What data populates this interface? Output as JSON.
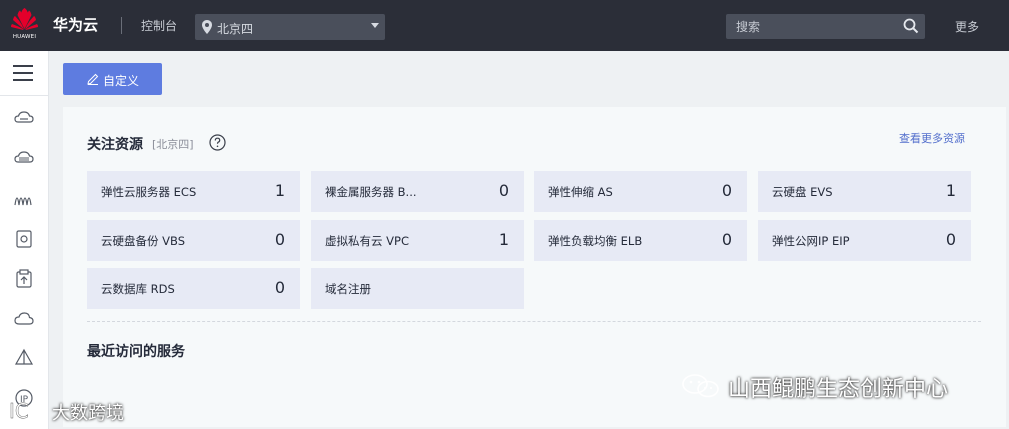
{
  "header": {
    "logo_text": "HUAWEI",
    "brand": "华为云",
    "console": "控制台",
    "region": "北京四",
    "search_placeholder": "搜索",
    "more": "更多"
  },
  "sidebar": {
    "icons": [
      "menu-icon",
      "cloud-server-icon",
      "cloud-disk-icon",
      "elastic-scaling-icon",
      "storage-icon",
      "backup-icon",
      "cloud-icon",
      "network-icon",
      "eip-icon"
    ]
  },
  "toolbar": {
    "customize_label": "自定义"
  },
  "focus": {
    "title": "关注资源",
    "region_tag": "[北京四]",
    "more_link": "查看更多资源",
    "cards": [
      {
        "name": "弹性云服务器 ECS",
        "count": "1"
      },
      {
        "name": "裸金属服务器 B...",
        "count": "0"
      },
      {
        "name": "弹性伸缩 AS",
        "count": "0"
      },
      {
        "name": "云硬盘 EVS",
        "count": "1"
      },
      {
        "name": "云硬盘备份 VBS",
        "count": "0"
      },
      {
        "name": "虚拟私有云 VPC",
        "count": "1"
      },
      {
        "name": "弹性负载均衡 ELB",
        "count": "0"
      },
      {
        "name": "弹性公网IP EIP",
        "count": "0"
      },
      {
        "name": "云数据库 RDS",
        "count": "0"
      },
      {
        "name": "域名注册",
        "count": ""
      }
    ]
  },
  "recent": {
    "title": "最近访问的服务"
  },
  "watermarks": {
    "right": "山西鲲鹏生态创新中心",
    "left": "大数跨境"
  }
}
